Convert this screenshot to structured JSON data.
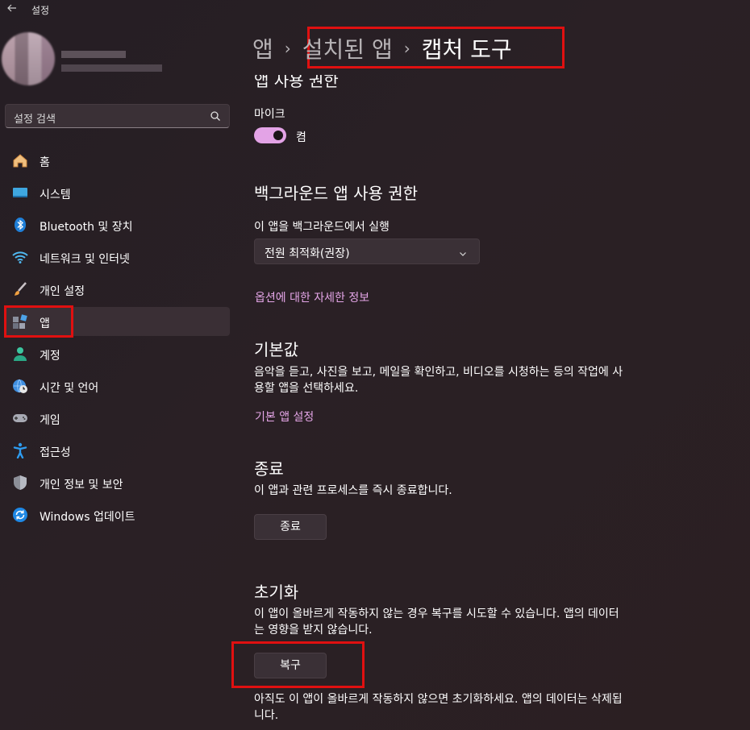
{
  "window": {
    "title": "설정",
    "back_icon": "back-arrow-icon"
  },
  "search": {
    "placeholder": "설정 검색"
  },
  "sidebar": {
    "items": [
      {
        "label": "홈",
        "icon": "home-icon"
      },
      {
        "label": "시스템",
        "icon": "system-icon"
      },
      {
        "label": "Bluetooth 및 장치",
        "icon": "bluetooth-icon"
      },
      {
        "label": "네트워크 및 인터넷",
        "icon": "wifi-icon"
      },
      {
        "label": "개인 설정",
        "icon": "brush-icon"
      },
      {
        "label": "앱",
        "icon": "apps-icon",
        "selected": true
      },
      {
        "label": "계정",
        "icon": "account-icon"
      },
      {
        "label": "시간 및 언어",
        "icon": "globe-clock-icon"
      },
      {
        "label": "게임",
        "icon": "gamepad-icon"
      },
      {
        "label": "접근성",
        "icon": "accessibility-icon"
      },
      {
        "label": "개인 정보 및 보안",
        "icon": "shield-icon"
      },
      {
        "label": "Windows 업데이트",
        "icon": "update-icon"
      }
    ]
  },
  "breadcrumb": {
    "root": "앱",
    "middle": "설치된 앱",
    "current": "캡처 도구"
  },
  "permissions": {
    "title": "앱 사용 권한",
    "mic_label": "마이크",
    "mic_state": "켬",
    "mic_on": true
  },
  "background": {
    "title": "백그라운드 앱 사용 권한",
    "run_label": "이 앱을 백그라운드에서 실행",
    "selected_option": "전원 최적화(권장)",
    "link": "옵션에 대한 자세한 정보"
  },
  "defaults": {
    "title": "기본값",
    "desc": "음악을 듣고, 사진을 보고, 메일을 확인하고, 비디오를 시청하는 등의 작업에 사용할 앱을 선택하세요.",
    "link": "기본 앱 설정"
  },
  "terminate": {
    "title": "종료",
    "desc": "이 앱과 관련 프로세스를 즉시 종료합니다.",
    "button": "종료"
  },
  "reset": {
    "title": "초기화",
    "desc": "이 앱이 올바르게 작동하지 않는 경우 복구를 시도할 수 있습니다. 앱의 데이터는 영향을 받지 않습니다.",
    "repair_button": "복구",
    "note": "아직도 이 앱이 올바르게 작동하지 않으면 초기화하세요. 앱의 데이터는 삭제됩니다."
  },
  "colors": {
    "accent": "#e3a3e6",
    "link": "#e5a6e8",
    "highlight": "#e01010"
  }
}
